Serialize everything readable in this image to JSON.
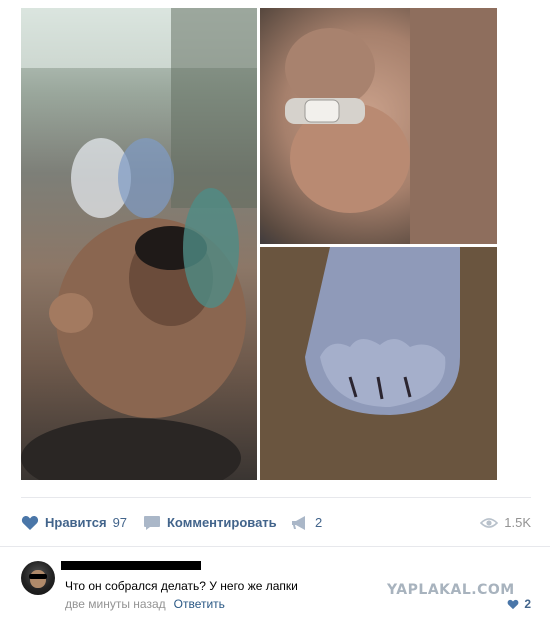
{
  "post": {
    "images": [
      {
        "alt": ""
      },
      {
        "alt": ""
      },
      {
        "alt": ""
      }
    ],
    "actions": {
      "like_label": "Нравится",
      "like_count": "97",
      "comment_label": "Комментировать",
      "share_count": "2",
      "views_count": "1.5K"
    },
    "icons": {
      "like": "heart-icon",
      "comment": "comment-bubble-icon",
      "share": "megaphone-icon",
      "views": "eye-icon"
    },
    "colors": {
      "link": "#2a5885",
      "icon": "#4a76a8",
      "muted": "#939393"
    }
  },
  "comment": {
    "text": "Что он собрался делать? У него же лапки",
    "time": "две минуты назад",
    "reply_label": "Ответить",
    "like_count": "2",
    "watermark": "YAPLAKAL.COM"
  }
}
